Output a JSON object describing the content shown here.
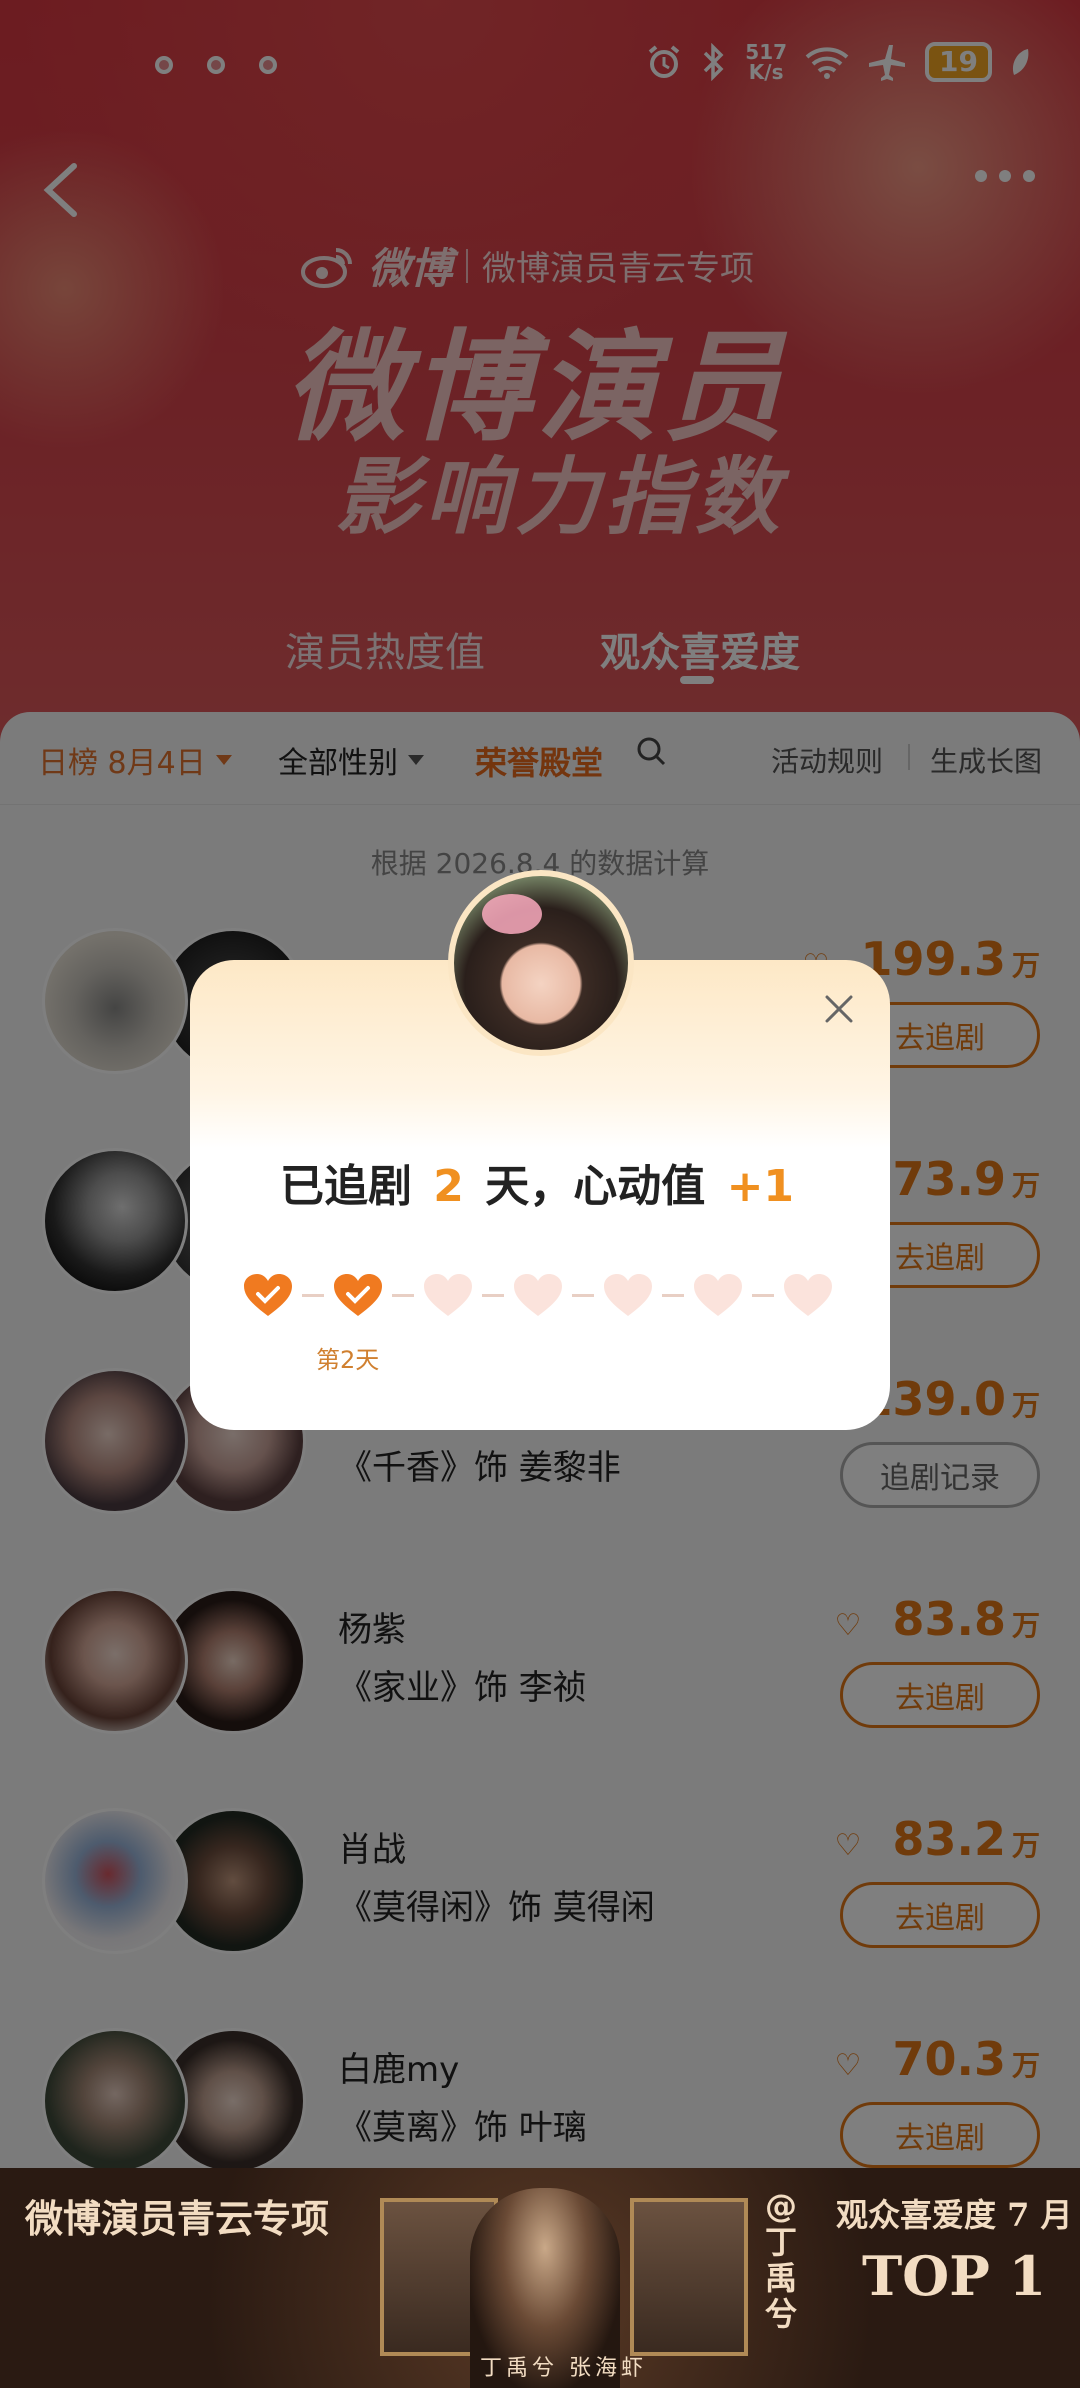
{
  "status_bar": {
    "speed_value": "517",
    "speed_unit": "K/s",
    "battery": "19"
  },
  "header": {
    "brand_logo": "微博",
    "brand_project": "微博演员青云专项",
    "title_line1": "微博演员",
    "title_line2": "影响力指数",
    "tabs": [
      {
        "label": "演员热度值"
      },
      {
        "label": "观众喜爱度"
      }
    ]
  },
  "filters": {
    "date": "日榜 8月4日",
    "gender": "全部性别",
    "hall_of_fame": "荣誉殿堂",
    "rules": "活动规则",
    "generate": "生成长图"
  },
  "basis_text": "根据 2026.8.4 的数据计算",
  "ranking": [
    {
      "name": "",
      "role": "",
      "score": "199.3",
      "unit": "万",
      "button": "去追剧"
    },
    {
      "name": "",
      "role": "",
      "score": "173.9",
      "unit": "万",
      "button": "去追剧"
    },
    {
      "name": "",
      "role": "《千香》饰 姜黎非",
      "score": "139.0",
      "unit": "万",
      "button": "追剧记录"
    },
    {
      "name": "杨紫",
      "role": "《家业》饰 李祯",
      "score": "83.8",
      "unit": "万",
      "button": "去追剧"
    },
    {
      "name": "肖战",
      "role": "《莫得闲》饰 莫得闲",
      "score": "83.2",
      "unit": "万",
      "button": "去追剧"
    },
    {
      "name": "白鹿my",
      "role": "《莫离》饰 叶璃",
      "score": "70.3",
      "unit": "万",
      "button": "去追剧"
    }
  ],
  "banner": {
    "title": "微博演员青云专项",
    "vertical_text": "@丁禹兮",
    "rank_label": "观众喜爱度 7 月",
    "rank_value": "TOP 1",
    "names": "丁禹兮 张海虾"
  },
  "modal": {
    "text_prefix": "已追剧",
    "days": "2",
    "text_mid": "天，心动值",
    "bonus": "+1",
    "day_label": "第2天",
    "total_hearts": 7,
    "filled_hearts": 2
  }
}
